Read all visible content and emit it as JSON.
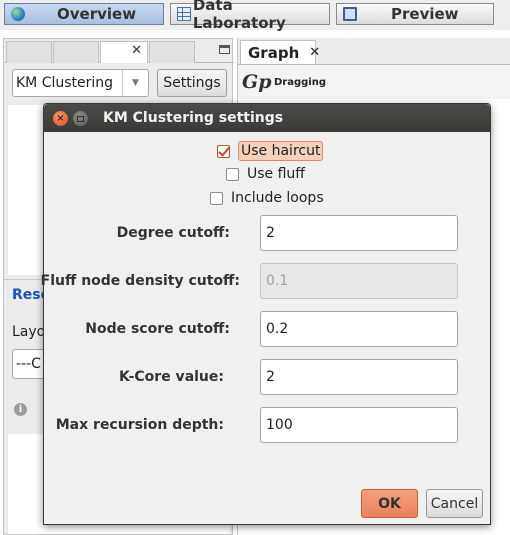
{
  "toolbar": {
    "overview_label": "Overview",
    "data_lab_label": "Data Laboratory",
    "preview_label": "Preview"
  },
  "left_panel": {
    "combo_value": "KM Clustering",
    "settings_label": "Settings",
    "reset_label": "Rese",
    "layout_label": "Layo",
    "layout_combo_value": "---C"
  },
  "graph_panel": {
    "tab_label": "Graph",
    "tool_glyph": "Gp",
    "mode_label": "Dragging"
  },
  "dialog": {
    "title": "KM Clustering settings",
    "checkboxes": [
      {
        "label": "Use haircut",
        "checked": true
      },
      {
        "label": "Use fluff",
        "checked": false
      },
      {
        "label": "Include loops",
        "checked": false
      }
    ],
    "fields": [
      {
        "label": "Degree cutoff:",
        "value": "2",
        "enabled": true
      },
      {
        "label": "Fluff node density cutoff:",
        "value": "0.1",
        "enabled": false
      },
      {
        "label": "Node score cutoff:",
        "value": "0.2",
        "enabled": true
      },
      {
        "label": "K-Core value:",
        "value": "2",
        "enabled": true
      },
      {
        "label": "Max recursion depth:",
        "value": "100",
        "enabled": true
      }
    ],
    "ok_label": "OK",
    "cancel_label": "Cancel"
  },
  "colors": {
    "accent": "#e9815c",
    "titlebar": "#3d3d3a",
    "link": "#1a52c9"
  }
}
